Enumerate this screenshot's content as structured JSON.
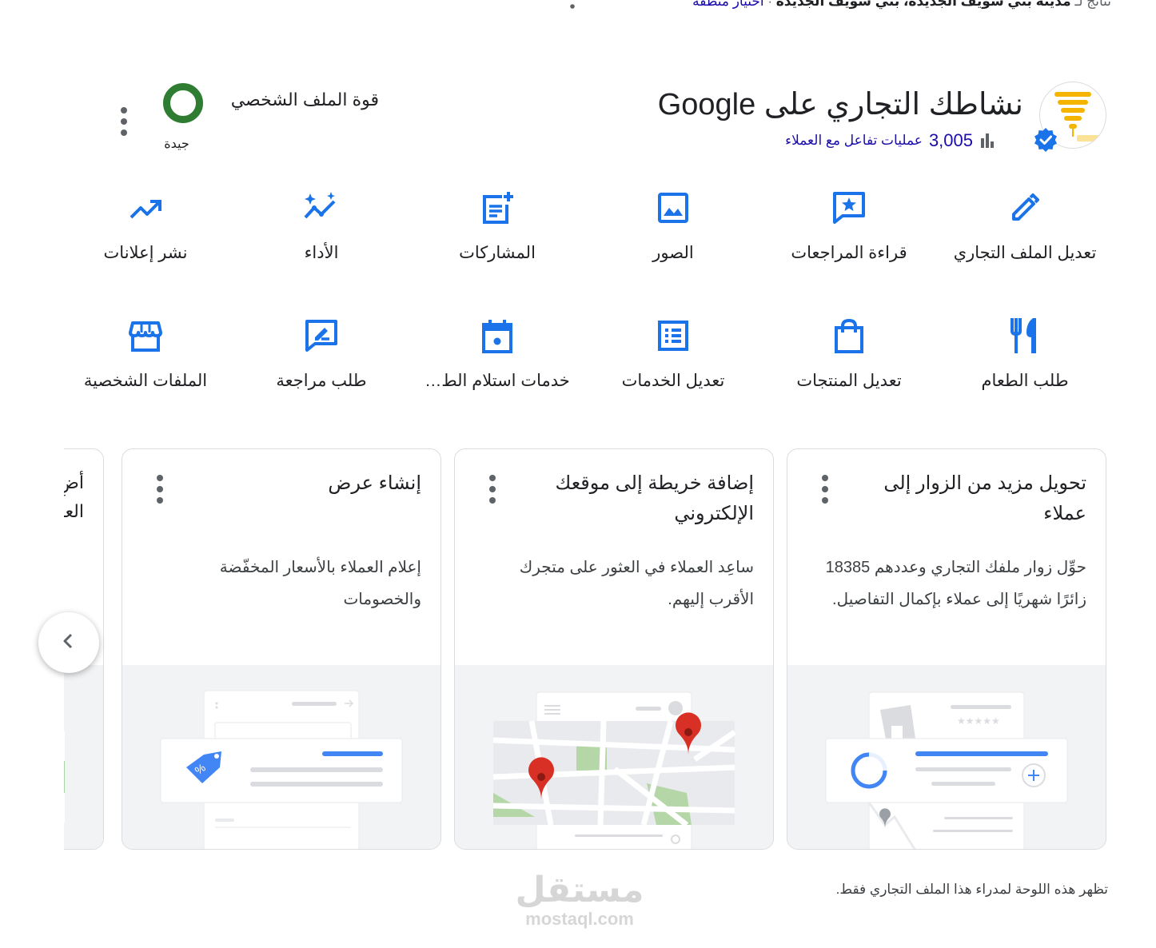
{
  "top_line": {
    "prefix": "نتائج لـ",
    "city": "مدينة بني سويف الجديدة، بني سويف الجديدة",
    "sep": "·",
    "choose_area": "اختيار منطقة"
  },
  "header": {
    "title": "نشاطك التجاري على Google",
    "interactions_count": "3,005",
    "interactions_label": "عمليات تفاعل مع العملاء",
    "profile_strength_label": "قوة الملف الشخصي",
    "profile_strength_value": "جيدة"
  },
  "actions_row1": [
    {
      "label": "تعديل الملف التجاري",
      "icon": "pencil-icon"
    },
    {
      "label": "قراءة المراجعات",
      "icon": "review-star-icon"
    },
    {
      "label": "الصور",
      "icon": "photo-icon"
    },
    {
      "label": "المشاركات",
      "icon": "post-add-icon"
    },
    {
      "label": "الأداء",
      "icon": "performance-sparkle-icon"
    },
    {
      "label": "نشر إعلانات",
      "icon": "trending-up-icon"
    }
  ],
  "actions_row2": [
    {
      "label": "طلب الطعام",
      "icon": "fork-knife-icon"
    },
    {
      "label": "تعديل المنتجات",
      "icon": "shopping-bag-icon"
    },
    {
      "label": "تعديل الخدمات",
      "icon": "list-icon"
    },
    {
      "label": "خدمات استلام الط…",
      "icon": "calendar-icon"
    },
    {
      "label": "طلب مراجعة",
      "icon": "rate-review-icon"
    },
    {
      "label": "الملفات الشخصية",
      "icon": "storefront-icon"
    }
  ],
  "cards": [
    {
      "title": "تحويل مزيد من الزوار إلى عملاء",
      "desc": "حوِّل زوار ملفك التجاري وعددهم 18385 زائرًا شهريًا إلى عملاء بإكمال التفاصيل."
    },
    {
      "title": "إضافة خريطة إلى موقعك الإلكتروني",
      "desc": "ساعِد العملاء في العثور على متجرك الأقرب إليهم."
    },
    {
      "title": "إنشاء عرض",
      "desc": "إعلام العملاء بالأسعار المخفّضة والخصومات"
    }
  ],
  "partial_card": {
    "text": "أضِ الر الا اعر العم"
  },
  "footer_note": "تظهر هذه اللوحة لمدراء هذا الملف التجاري فقط.",
  "watermark": {
    "arabic": "مستقل",
    "latin": "mostaql.com"
  },
  "colors": {
    "accent": "#1a73e8",
    "link": "#1a0dab",
    "strength_ring": "#2e7d32",
    "map_pin": "#d93025",
    "verified": "#1a73e8"
  }
}
